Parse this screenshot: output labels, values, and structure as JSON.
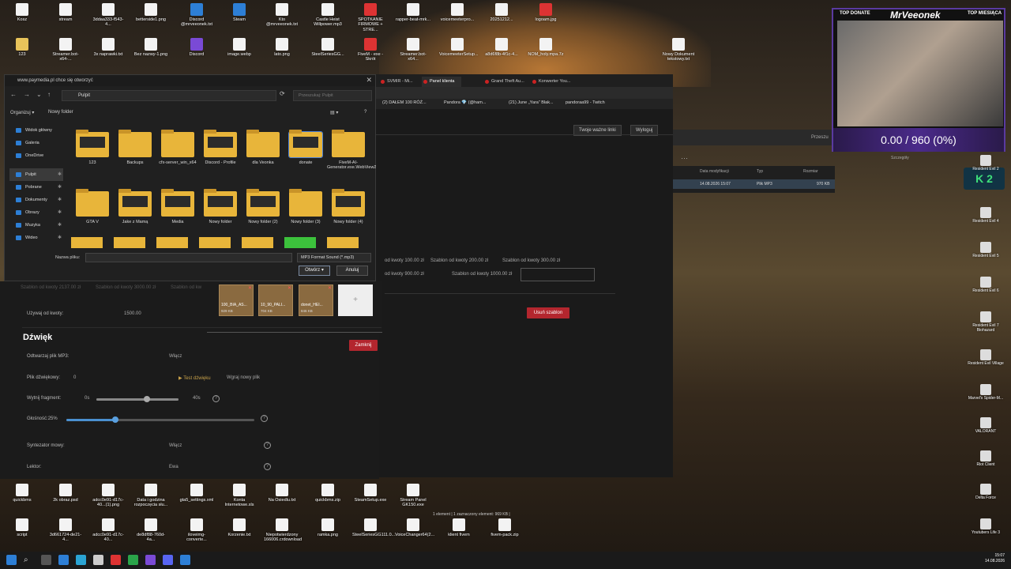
{
  "desktop_top": [
    {
      "label": "Kosz",
      "cls": "file"
    },
    {
      "label": "stream",
      "cls": "file"
    },
    {
      "label": "3ddaa333-f543-4...",
      "cls": "file"
    },
    {
      "label": "betterside1.png",
      "cls": "file"
    },
    {
      "label": "Discord @mrveeonek.txt",
      "cls": "blue"
    },
    {
      "label": "Steam",
      "cls": "blue"
    },
    {
      "label": "Kto @mrveeonek.txt",
      "cls": "file"
    },
    {
      "label": "Castle Heist Willpower.mp3",
      "cls": "file"
    },
    {
      "label": "SPOTKANIE FIRMOWE + STRE...",
      "cls": "red"
    },
    {
      "label": "rapper-beat-mrk...",
      "cls": "file"
    },
    {
      "label": "voicemeeterpro...",
      "cls": "file"
    },
    {
      "label": "20251212...",
      "cls": "file"
    },
    {
      "label": "logoam.jpg",
      "cls": "red"
    }
  ],
  "desktop_row2": [
    {
      "label": "123",
      "cls": ""
    },
    {
      "label": "Streamer.bot-x64-...",
      "cls": "file"
    },
    {
      "label": "3x naprawki.txt",
      "cls": "file"
    },
    {
      "label": "Bez nazwy-1.png",
      "cls": "file"
    },
    {
      "label": "Discord",
      "cls": "purple"
    },
    {
      "label": "image.webp",
      "cls": "file"
    },
    {
      "label": "lato.png",
      "cls": "file"
    },
    {
      "label": "SteelSeriesGG...",
      "cls": "file"
    },
    {
      "label": "FiveM - exe - Skrót",
      "cls": "red"
    },
    {
      "label": "Streamer.bot-x64...",
      "cls": "file"
    },
    {
      "label": "VoicemeeterSetup...",
      "cls": "file"
    },
    {
      "label": "a8d6f8b-4f1c-4...",
      "cls": "file"
    },
    {
      "label": "NOM_holy.mpa.7z",
      "cls": "file"
    },
    {
      "label": "Nowy Dokument tekstowy.txt",
      "cls": "file"
    }
  ],
  "dialog": {
    "title": "www.paymedia.pl chce się otworzyć",
    "path": "Pulpit",
    "search_placeholder": "Przeszukaj: Pulpit",
    "organize": "Organizuj ▾",
    "new_folder": "Nowy folder",
    "sidebar": [
      {
        "label": "Widok główny",
        "pin": ""
      },
      {
        "label": "Galeria",
        "pin": ""
      },
      {
        "label": "OneDrive",
        "pin": ""
      },
      {
        "label": "Pulpit",
        "pin": "✱"
      },
      {
        "label": "Pobrane",
        "pin": "✱"
      },
      {
        "label": "Dokumenty",
        "pin": "✱"
      },
      {
        "label": "Obrazy",
        "pin": "✱"
      },
      {
        "label": "Muzyka",
        "pin": "✱"
      },
      {
        "label": "Wideo",
        "pin": "✱"
      }
    ],
    "folders_row1": [
      "123",
      "Backups",
      "cfx-server_win_x64",
      "Discord - Profile",
      "dla Veonka",
      "donate",
      "FiveM-AI-Generator.exe.WebView2"
    ],
    "folders_row2": [
      "GTA V",
      "Jake z Mamą",
      "Media",
      "Nowy folder",
      "Nowy folder (2)",
      "Nowy folder (3)",
      "Nowy folder (4)"
    ],
    "filename_label": "Nazwa pliku:",
    "filetype": "MP3 Format Sound (*.mp3)",
    "open": "Otwórz",
    "cancel": "Anuluj"
  },
  "browser": {
    "tabs": [
      "SVMIR - Mi...",
      "Panel klienta",
      "Grand Theft Au...",
      "Konwerter You..."
    ],
    "bookmarks": [
      "(2) DAŁEM 100 RÓŻ...",
      "Pandora 💎 (@ham...",
      "(21) June „Yara\" Blak...",
      "pandoraa99 - Twitch"
    ],
    "important_links": "Twoje ważne linki",
    "logout": "Wyloguj",
    "search_cut": "Przeszu"
  },
  "templates": {
    "row1": [
      "od kwoty 100.00 zł",
      "Szablon od kwoty 200.00 zł",
      "Szablon od kwoty 300.00 zł"
    ],
    "row2": [
      "od kwoty 900.00 zł",
      "Szablon od kwoty 1000.00 zł"
    ],
    "left_cut": [
      "Szablon od kwoty 2137.00 zł",
      "Szablon od kwoty 3000.00 zł",
      "Szablon od kw"
    ],
    "delete": "Usuń szablon"
  },
  "mp3_files": [
    {
      "name": "100_BIA_AS...",
      "size": "929 KB"
    },
    {
      "name": "10_90_PALI...",
      "size": "704 KB"
    },
    {
      "name": "donet_HEI...",
      "size": "846 KB"
    }
  ],
  "close_btn": "Zamknij",
  "form": {
    "use_from_label": "Używaj od kwoty:",
    "use_from_value": "1500.00",
    "sound_title": "Dźwięk",
    "play_mp3_label": "Odtwarzaj plik MP3:",
    "play_mp3_value": "Włącz",
    "sound_file_label": "Plik dźwiękowy:",
    "sound_file_value": "0",
    "test_sound": "Test dźwięku",
    "upload_new": "Wgraj nowy plik",
    "cut_label": "Wytnij fragment:",
    "cut_start": "0s",
    "cut_end": "40s",
    "volume_label": "Głośność:",
    "volume_value": "25%",
    "tts_label": "Syntezator mowy:",
    "tts_value": "Włącz",
    "reader_label": "Lektor:",
    "reader_value": "Ewa"
  },
  "explorer": {
    "headers": [
      "Data modyfikacji",
      "Typ",
      "Rozmiar"
    ],
    "row": [
      "14.08.2026 15:07",
      "Plik MP3",
      "970 KB"
    ],
    "details": "Szczegóły",
    "status": "1 element  |  1 zaznaczony element: 969 KB  |"
  },
  "overlay": {
    "top_left": "TOP DONATE",
    "name": "MrVeeonek",
    "top_right": "TOP MIESIĄCA",
    "donate_progress": "0.00 / 960 (0%)",
    "kz": "K 2"
  },
  "right_icons": [
    "Resident Evil 2",
    "Resident Evil 4",
    "Resident Evil 5",
    "Resident Evil 6",
    "Resident Evil 7 Biohazard",
    "Resident Evil Village",
    "Marvel's Spider-M...",
    "VALORANT",
    "Riot Client",
    "Delta Force",
    "Youtubers Life 3"
  ],
  "desktop_bottom1": [
    "quickbms",
    "2k obraz.psd",
    "adcc0e91-d17c-40...(1).png",
    "Data i godzina rozpoczęcia słu...",
    "gta5_settings.xml",
    "Konta Internetowe.xls",
    "Na Osiedlu.txt",
    "quickbms.zip",
    "SteamSetup.exe",
    "Stream Panel GK150.exe"
  ],
  "desktop_bottom2": [
    "script",
    "3d661724-de21-4...",
    "adcc0e91-d17c-40...",
    "de8df88-760d-4a...",
    "iloveimg-converte...",
    "Korzenie.txt",
    "Niepotwierdzony 166006.crdownload",
    "ramka.png",
    "SteelSeriesGG111.0...",
    "VoiceChanger64(2...",
    "klient fivem",
    "fivem-pack.zip"
  ],
  "clock": {
    "time": "15:07",
    "date": "14.08.2026"
  }
}
